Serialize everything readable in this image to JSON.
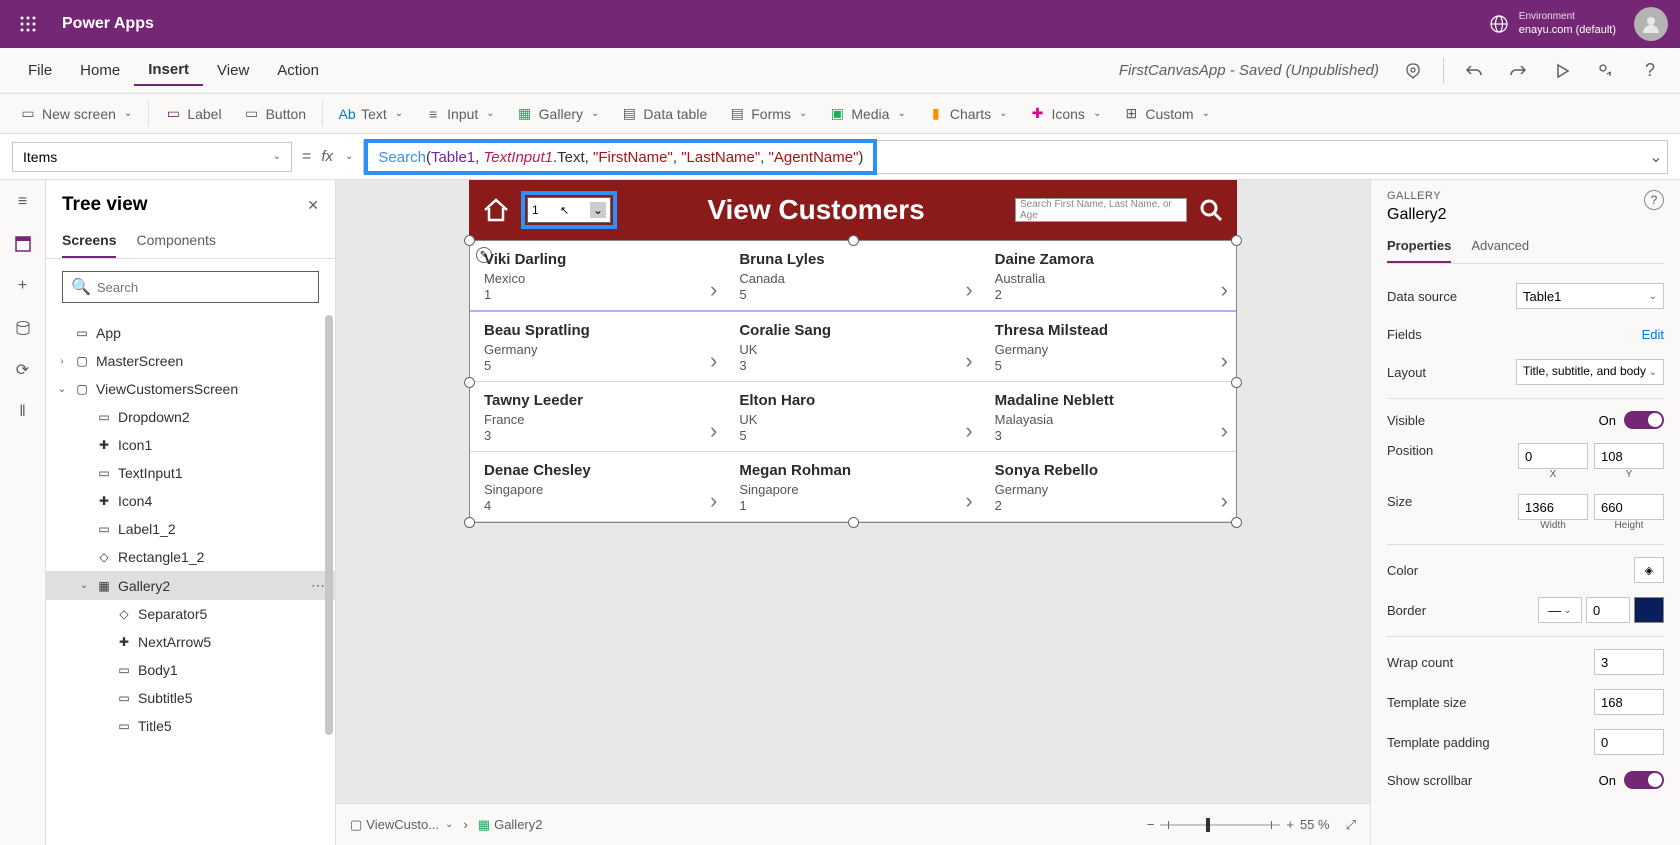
{
  "header": {
    "app_title": "Power Apps",
    "env_label": "Environment",
    "env_name": "enayu.com (default)"
  },
  "menubar": {
    "items": [
      "File",
      "Home",
      "Insert",
      "View",
      "Action"
    ],
    "active_index": 2,
    "status": "FirstCanvasApp - Saved (Unpublished)"
  },
  "ribbon": {
    "new_screen": "New screen",
    "label": "Label",
    "button": "Button",
    "text": "Text",
    "input": "Input",
    "gallery": "Gallery",
    "data_table": "Data table",
    "forms": "Forms",
    "media": "Media",
    "charts": "Charts",
    "icons": "Icons",
    "custom": "Custom"
  },
  "formula": {
    "property": "Items",
    "fn": "Search",
    "table": "Table1",
    "var": "TextInput1",
    "member": ".Text",
    "arg1": "\"FirstName\"",
    "arg2": "\"LastName\"",
    "arg3": "\"AgentName\""
  },
  "tree": {
    "title": "Tree view",
    "tabs": [
      "Screens",
      "Components"
    ],
    "search_placeholder": "Search",
    "items": [
      {
        "label": "App",
        "indent": 0,
        "chev": "",
        "icon": "▭"
      },
      {
        "label": "MasterScreen",
        "indent": 0,
        "chev": "›",
        "icon": "▢"
      },
      {
        "label": "ViewCustomersScreen",
        "indent": 0,
        "chev": "⌄",
        "icon": "▢"
      },
      {
        "label": "Dropdown2",
        "indent": 1,
        "chev": "",
        "icon": "▭"
      },
      {
        "label": "Icon1",
        "indent": 1,
        "chev": "",
        "icon": "✚"
      },
      {
        "label": "TextInput1",
        "indent": 1,
        "chev": "",
        "icon": "▭"
      },
      {
        "label": "Icon4",
        "indent": 1,
        "chev": "",
        "icon": "✚"
      },
      {
        "label": "Label1_2",
        "indent": 1,
        "chev": "",
        "icon": "▭"
      },
      {
        "label": "Rectangle1_2",
        "indent": 1,
        "chev": "",
        "icon": "◇"
      },
      {
        "label": "Gallery2",
        "indent": 1,
        "chev": "⌄",
        "icon": "▦",
        "selected": true
      },
      {
        "label": "Separator5",
        "indent": 2,
        "chev": "",
        "icon": "◇"
      },
      {
        "label": "NextArrow5",
        "indent": 2,
        "chev": "",
        "icon": "✚"
      },
      {
        "label": "Body1",
        "indent": 2,
        "chev": "",
        "icon": "▭"
      },
      {
        "label": "Subtitle5",
        "indent": 2,
        "chev": "",
        "icon": "▭"
      },
      {
        "label": "Title5",
        "indent": 2,
        "chev": "",
        "icon": "▭"
      }
    ]
  },
  "canvas": {
    "title": "View Customers",
    "dropdown_value": "1",
    "search_placeholder": "Search First Name, Last Name, or Age",
    "rows": [
      [
        {
          "name": "Viki  Darling",
          "sub": "Mexico",
          "n": "1"
        },
        {
          "name": "Bruna  Lyles",
          "sub": "Canada",
          "n": "5"
        },
        {
          "name": "Daine  Zamora",
          "sub": "Australia",
          "n": "2"
        }
      ],
      [
        {
          "name": "Beau  Spratling",
          "sub": "Germany",
          "n": "5"
        },
        {
          "name": "Coralie  Sang",
          "sub": "UK",
          "n": "3"
        },
        {
          "name": "Thresa  Milstead",
          "sub": "Germany",
          "n": "5"
        }
      ],
      [
        {
          "name": "Tawny  Leeder",
          "sub": "France",
          "n": "3"
        },
        {
          "name": "Elton  Haro",
          "sub": "UK",
          "n": "5"
        },
        {
          "name": "Madaline  Neblett",
          "sub": "Malayasia",
          "n": "3"
        }
      ],
      [
        {
          "name": "Denae  Chesley",
          "sub": "Singapore",
          "n": "4"
        },
        {
          "name": "Megan  Rohman",
          "sub": "Singapore",
          "n": "1"
        },
        {
          "name": "Sonya  Rebello",
          "sub": "Germany",
          "n": "2"
        }
      ]
    ]
  },
  "footer": {
    "bc1": "ViewCusto...",
    "bc2": "Gallery2",
    "zoom": "55 %"
  },
  "props": {
    "cat": "GALLERY",
    "name": "Gallery2",
    "tabs": [
      "Properties",
      "Advanced"
    ],
    "datasource_label": "Data source",
    "datasource_val": "Table1",
    "fields_label": "Fields",
    "edit": "Edit",
    "layout_label": "Layout",
    "layout_val": "Title, subtitle, and body",
    "visible_label": "Visible",
    "visible_on": "On",
    "position_label": "Position",
    "pos_x": "0",
    "pos_y": "108",
    "x_label": "X",
    "y_label": "Y",
    "size_label": "Size",
    "width": "1366",
    "height": "660",
    "w_label": "Width",
    "h_label": "Height",
    "color_label": "Color",
    "border_label": "Border",
    "border_val": "0",
    "wrap_label": "Wrap count",
    "wrap_val": "3",
    "tmpl_size_label": "Template size",
    "tmpl_size_val": "168",
    "tmpl_pad_label": "Template padding",
    "tmpl_pad_val": "0",
    "scroll_label": "Show scrollbar",
    "scroll_on": "On"
  }
}
